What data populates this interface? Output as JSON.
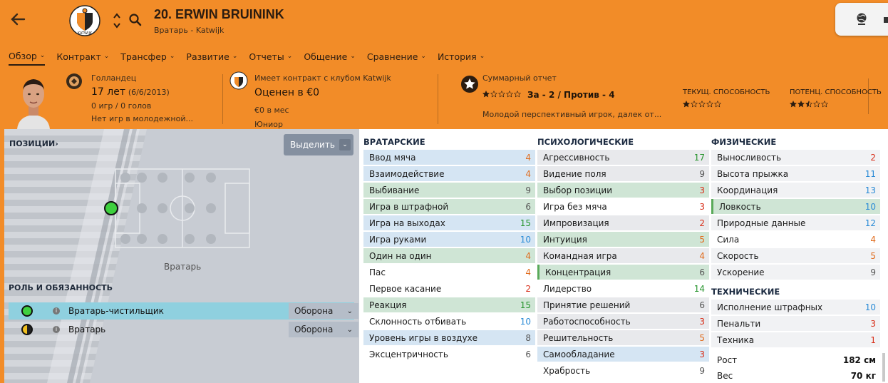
{
  "header": {
    "back": "←",
    "title": "20. ERWIN BRUININK",
    "subtitle": "Вратарь - Katwijk",
    "club_logo_text": "KATWIJK"
  },
  "tabs": [
    {
      "label": "Обзор",
      "chev": "⌄"
    },
    {
      "label": "Контракт",
      "chev": "⌄"
    },
    {
      "label": "Трансфер",
      "chev": "⌄"
    },
    {
      "label": "Развитие",
      "chev": "⌄"
    },
    {
      "label": "Отчеты",
      "chev": "⌄"
    },
    {
      "label": "Общение",
      "chev": "⌄"
    },
    {
      "label": "Сравнение",
      "chev": "⌄"
    },
    {
      "label": "История",
      "chev": "⌄"
    }
  ],
  "info": {
    "nationality": "Голландец",
    "age": "17 лет",
    "birth": "(6/6/2013)",
    "games": "0 игр / 0 голов",
    "youth": "Нет игр в молодежной...",
    "contract": "Имеет контракт с клубом Katwijk",
    "value": "Оценен в €0",
    "wage": "€0 в мес",
    "level": "Юниор",
    "report_title": "Суммарный отчет",
    "report_score": "За - 2 / Против - 4",
    "report_text": "Молодой перспективный игрок, далек от...",
    "current_ability": "ТЕКУЩ. СПОСОБНОСТЬ",
    "potential_ability": "ПОТЕНЦ. СПОСОБНОСТЬ",
    "report_stars": 1,
    "current_stars": 1,
    "potential_stars": 2.5,
    "stars_total": 5
  },
  "positions": {
    "title": "ПОЗИЦИИ",
    "title_chev": "›",
    "select_label": "Выделить",
    "select_chev": "⌄",
    "pitch_label": "Вратарь"
  },
  "roles": {
    "title": "РОЛЬ И ОБЯЗАННОСТЬ",
    "items": [
      {
        "name": "Вратарь-чистильщик",
        "duty": "Оборона",
        "info": "i",
        "chev": "⌄"
      },
      {
        "name": "Вратарь",
        "duty": "Оборона",
        "info": "i",
        "chev": "⌄"
      }
    ]
  },
  "attributes": {
    "goalkeeping": {
      "title": "ВРАТАРСКИЕ",
      "rows": [
        {
          "name": "Ввод мяча",
          "value": 4
        },
        {
          "name": "Взаимодействие",
          "value": 4
        },
        {
          "name": "Выбивание",
          "value": 9
        },
        {
          "name": "Игра в штрафной",
          "value": 6
        },
        {
          "name": "Игра на выходах",
          "value": 15
        },
        {
          "name": "Игра руками",
          "value": 10
        },
        {
          "name": "Один на один",
          "value": 4
        },
        {
          "name": "Пас",
          "value": 4
        },
        {
          "name": "Первое касание",
          "value": 2
        },
        {
          "name": "Реакция",
          "value": 15
        },
        {
          "name": "Склонность отбивать",
          "value": 10
        },
        {
          "name": "Уровень игры в воздухе",
          "value": 8
        },
        {
          "name": "Эксцентричность",
          "value": 6
        }
      ]
    },
    "mental": {
      "title": "ПСИХОЛОГИЧЕСКИЕ",
      "rows": [
        {
          "name": "Агрессивность",
          "value": 17
        },
        {
          "name": "Видение поля",
          "value": 9
        },
        {
          "name": "Выбор позиции",
          "value": 3
        },
        {
          "name": "Игра без мяча",
          "value": 3
        },
        {
          "name": "Импровизация",
          "value": 2
        },
        {
          "name": "Интуиция",
          "value": 5
        },
        {
          "name": "Командная игра",
          "value": 4
        },
        {
          "name": "Концентрация",
          "value": 6
        },
        {
          "name": "Лидерство",
          "value": 14
        },
        {
          "name": "Принятие решений",
          "value": 6
        },
        {
          "name": "Работоспособность",
          "value": 3
        },
        {
          "name": "Решительность",
          "value": 5
        },
        {
          "name": "Самообладание",
          "value": 3
        },
        {
          "name": "Храбрость",
          "value": 9
        }
      ]
    },
    "physical": {
      "title": "ФИЗИЧЕСКИЕ",
      "rows": [
        {
          "name": "Выносливость",
          "value": 2
        },
        {
          "name": "Высота прыжка",
          "value": 11
        },
        {
          "name": "Координация",
          "value": 13
        },
        {
          "name": "Ловкость",
          "value": 10
        },
        {
          "name": "Природные данные",
          "value": 12
        },
        {
          "name": "Сила",
          "value": 4
        },
        {
          "name": "Скорость",
          "value": 5
        },
        {
          "name": "Ускорение",
          "value": 9
        }
      ]
    },
    "technical": {
      "title": "ТЕХНИЧЕСКИЕ",
      "rows": [
        {
          "name": "Исполнение штрафных",
          "value": 10
        },
        {
          "name": "Пенальти",
          "value": 3
        },
        {
          "name": "Техника",
          "value": 1
        }
      ]
    },
    "body": [
      {
        "name": "Рост",
        "value": "182 см"
      },
      {
        "name": "Вес",
        "value": "70 кг"
      }
    ]
  },
  "colors": {
    "orange_bg": "#f28c28",
    "red": "#d8301b",
    "orange": "#e06b1c",
    "gray": "#555555",
    "blue": "#2a8bd6",
    "green": "#27942d"
  }
}
